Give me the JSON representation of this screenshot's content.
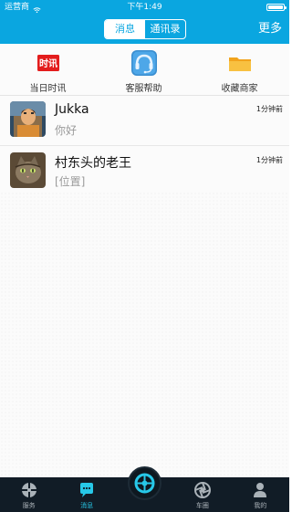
{
  "status_bar": {
    "carrier": "运营商",
    "time": "下午1:49",
    "wifi_icon": "wifi-icon",
    "battery_level": 1.0
  },
  "header": {
    "tabs": [
      "消息",
      "通讯录"
    ],
    "active_tab": 0,
    "more": "更多",
    "colors": {
      "brand": "#0aa6e0"
    }
  },
  "shortcuts": [
    {
      "label": "当日时讯",
      "icon": "news-icon",
      "badge": "时讯"
    },
    {
      "label": "客服帮助",
      "icon": "customer-service-icon"
    },
    {
      "label": "收藏商家",
      "icon": "folder-icon"
    }
  ],
  "conversations": [
    {
      "name": "Jukka",
      "preview": "你好",
      "time": "1分钟前",
      "avatar": "person-avatar"
    },
    {
      "name": "村东头的老王",
      "preview": "[位置]",
      "time": "1分钟前",
      "avatar": "cat-avatar"
    }
  ],
  "tabbar": {
    "items": [
      {
        "label": "服务",
        "icon": "service-icon"
      },
      {
        "label": "消息",
        "icon": "message-icon",
        "active": true
      },
      {
        "label": "",
        "icon": "wheel-center-icon"
      },
      {
        "label": "车圈",
        "icon": "aperture-icon"
      },
      {
        "label": "我的",
        "icon": "user-icon"
      }
    ],
    "colors": {
      "active": "#27c8e8",
      "inactive": "#aab2b8",
      "background": "#111c26"
    }
  }
}
